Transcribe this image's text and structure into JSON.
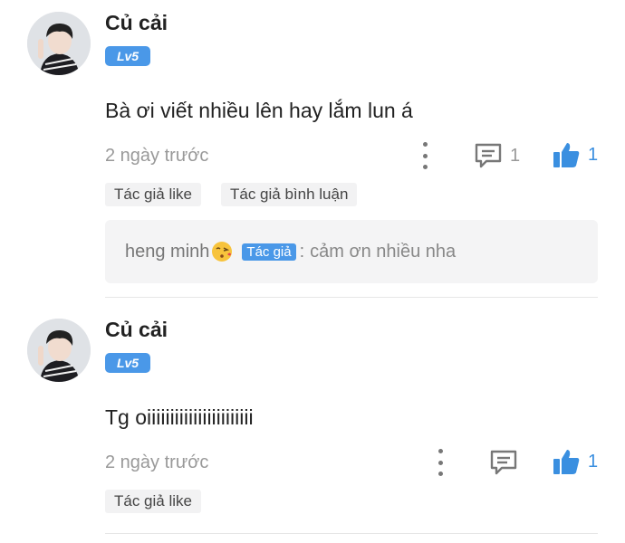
{
  "comments": [
    {
      "username": "Củ cải",
      "level": "Lv5",
      "text": "Bà ơi viết nhiều lên hay lắm lun á",
      "time": "2 ngày trước",
      "reply_count": "1",
      "like_count": "1",
      "tags": [
        "Tác giả like",
        "Tác giả bình luận"
      ],
      "reply": {
        "author": "heng minh",
        "badge": "Tác giả",
        "separator": ":",
        "text": "cảm ơn nhiều nha"
      }
    },
    {
      "username": "Củ cải",
      "level": "Lv5",
      "text": "Tg oiiiiiiiiiiiiiiiiiiiiiii",
      "time": "2 ngày trước",
      "like_count": "1",
      "tags": [
        "Tác giả like"
      ]
    }
  ],
  "icons": {
    "more": "more-vertical-icon",
    "comment": "comment-icon",
    "like": "thumbs-up-icon",
    "emoji": "kissing-face-emoji"
  },
  "colors": {
    "accent": "#4a98e8",
    "like": "#3a8fe0",
    "muted": "#999999",
    "tag_bg": "#f2f2f3",
    "reply_bg": "#f4f4f5"
  }
}
